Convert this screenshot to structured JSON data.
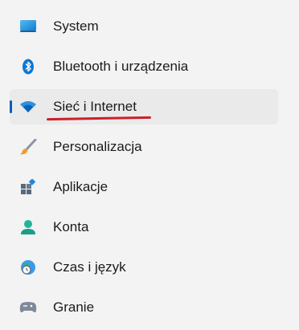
{
  "nav": {
    "items": [
      {
        "id": "system",
        "label": "System",
        "icon": "monitor-icon"
      },
      {
        "id": "bluetooth",
        "label": "Bluetooth i urządzenia",
        "icon": "bluetooth-icon"
      },
      {
        "id": "network",
        "label": "Sieć i Internet",
        "icon": "wifi-icon",
        "selected": true
      },
      {
        "id": "personalization",
        "label": "Personalizacja",
        "icon": "brush-icon"
      },
      {
        "id": "apps",
        "label": "Aplikacje",
        "icon": "apps-icon"
      },
      {
        "id": "accounts",
        "label": "Konta",
        "icon": "person-icon"
      },
      {
        "id": "time",
        "label": "Czas i język",
        "icon": "globe-clock-icon"
      },
      {
        "id": "gaming",
        "label": "Granie",
        "icon": "gamepad-icon"
      }
    ]
  },
  "colors": {
    "accent": "#005fb8",
    "annotation_underline": "#cc1f2a",
    "selected_bg": "#eaeaea",
    "background": "#f3f3f3"
  }
}
